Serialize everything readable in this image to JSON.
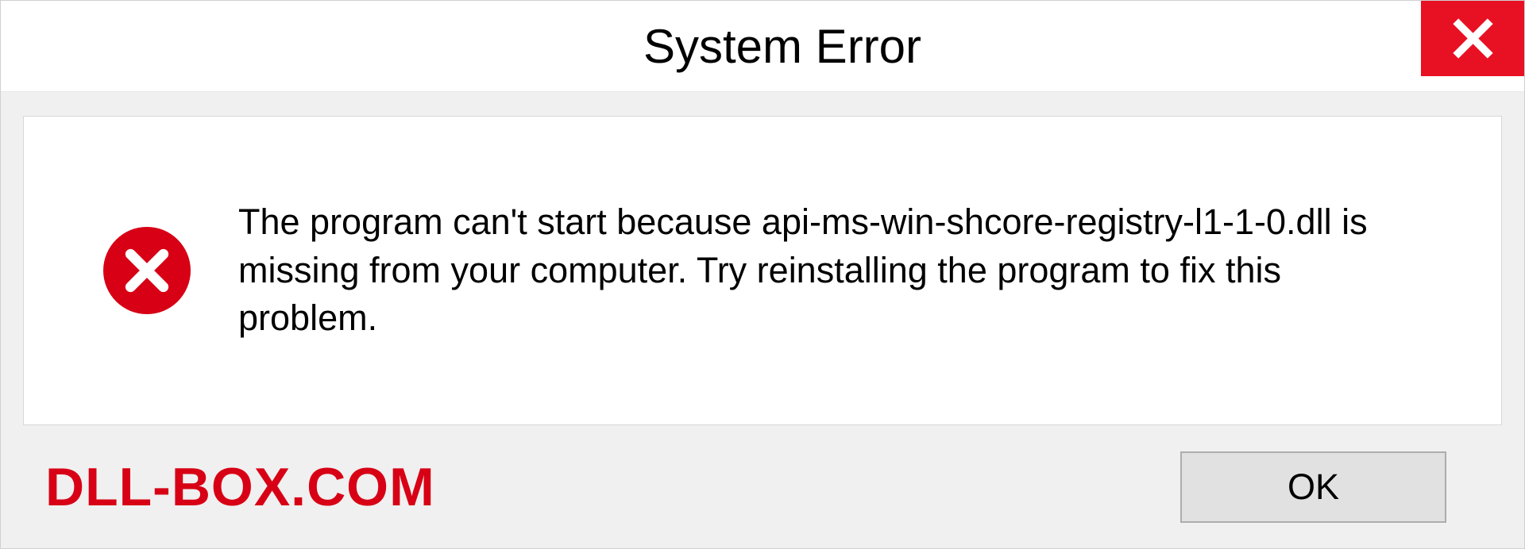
{
  "titlebar": {
    "title": "System Error"
  },
  "content": {
    "message": "The program can't start because api-ms-win-shcore-registry-l1-1-0.dll is missing from your computer. Try reinstalling the program to fix this problem."
  },
  "footer": {
    "watermark": "DLL-BOX.COM",
    "ok_label": "OK"
  },
  "colors": {
    "close_bg": "#e81123",
    "error_icon_bg": "#d70015",
    "watermark_color": "#d70015"
  }
}
